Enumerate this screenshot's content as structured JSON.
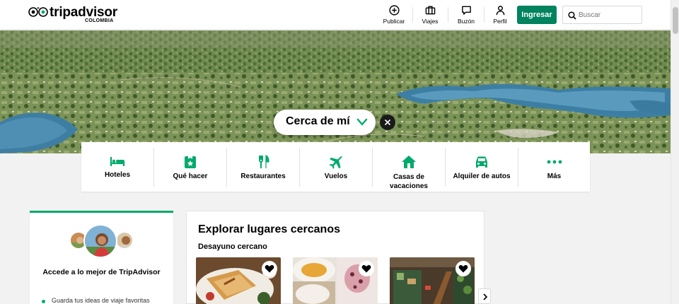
{
  "header": {
    "logo_text": "tripadvisor",
    "logo_country": "COLOMBIA",
    "nav": [
      {
        "label": "Publicar",
        "icon": "plus-circle-icon"
      },
      {
        "label": "Viajes",
        "icon": "suitcase-icon"
      },
      {
        "label": "Buzón",
        "icon": "message-icon"
      },
      {
        "label": "Perfil",
        "icon": "person-icon"
      }
    ],
    "login_label": "Ingresar",
    "search_placeholder": "Buscar"
  },
  "hero": {
    "location_label": "Cerca de mí"
  },
  "categories": [
    {
      "label": "Hoteles",
      "icon": "bed-icon"
    },
    {
      "label": "Qué hacer",
      "icon": "attraction-icon"
    },
    {
      "label": "Restaurantes",
      "icon": "fork-knife-icon"
    },
    {
      "label": "Vuelos",
      "icon": "plane-icon"
    },
    {
      "label": "Casas de vacaciones",
      "icon": "house-icon"
    },
    {
      "label": "Alquiler de autos",
      "icon": "car-icon"
    },
    {
      "label": "Más",
      "icon": "more-dots-icon"
    }
  ],
  "promo": {
    "title": "Accede a lo mejor de TripAdvisor",
    "items": [
      "Guarda tus ideas de viaje favoritas"
    ]
  },
  "explore": {
    "title": "Explorar lugares cercanos",
    "subtitle": "Desayuno cercano"
  },
  "colors": {
    "brand_green": "#00835e",
    "accent_green": "#00aa6c"
  }
}
